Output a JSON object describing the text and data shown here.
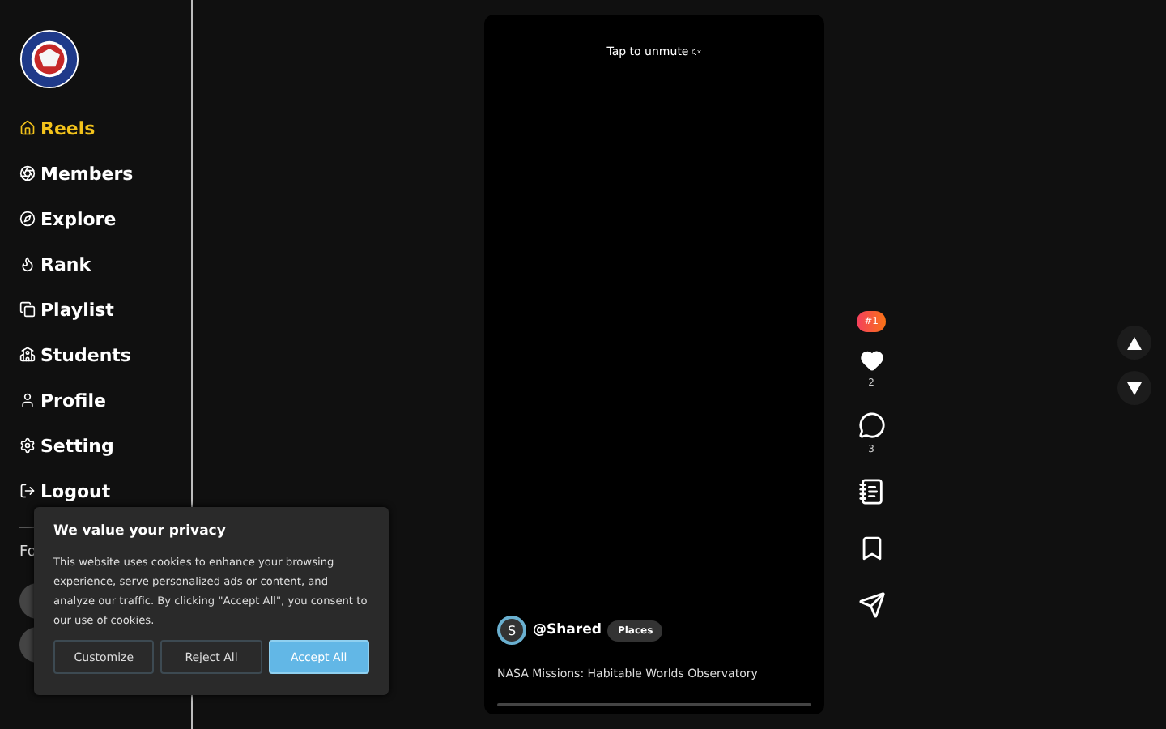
{
  "sidebar": {
    "items": [
      {
        "label": "Reels",
        "selected": true
      },
      {
        "label": "Members",
        "selected": false
      },
      {
        "label": "Explore",
        "selected": false
      },
      {
        "label": "Rank",
        "selected": false
      },
      {
        "label": "Playlist",
        "selected": false
      },
      {
        "label": "Students",
        "selected": false
      },
      {
        "label": "Profile",
        "selected": false
      },
      {
        "label": "Setting",
        "selected": false
      },
      {
        "label": "Logout",
        "selected": false
      }
    ],
    "follow_label": "Fo"
  },
  "video": {
    "hint": "Tap to unmute",
    "user": "@Shared",
    "avatar_letter": "S",
    "tag": "Places",
    "caption": "NASA Missions: Habitable Worlds Observatory"
  },
  "actions": {
    "rank_badge": "#1",
    "likes": "2",
    "comments": "3"
  },
  "cookie_banner": {
    "title": "We value your privacy",
    "text": "This website uses cookies to enhance your browsing experience, serve personalized ads or content, and analyze our traffic. By clicking \"Accept All\", you consent to our use of cookies.",
    "buttons": [
      {
        "label": "Customize",
        "kind": "outline"
      },
      {
        "label": "Reject All",
        "kind": "outline"
      },
      {
        "label": "Accept All",
        "kind": "primary"
      }
    ]
  }
}
